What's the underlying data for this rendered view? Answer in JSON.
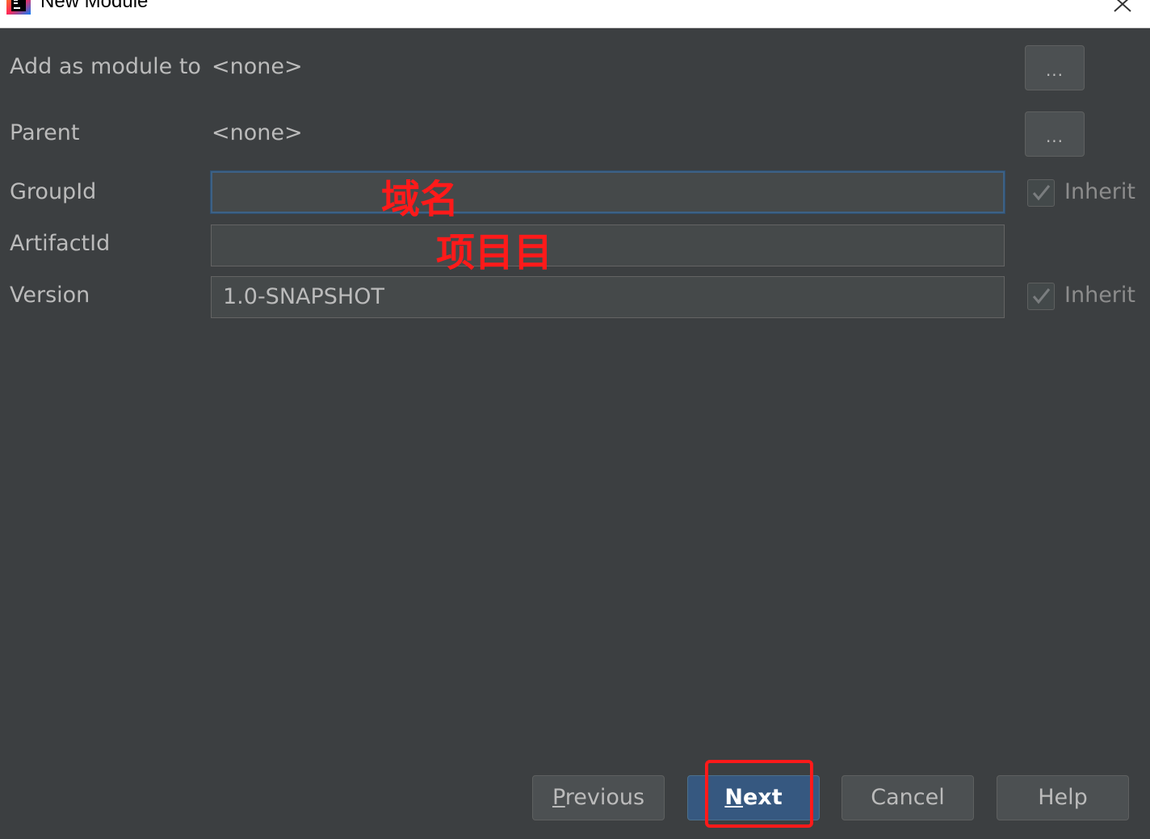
{
  "window": {
    "title": "New Module",
    "icon": "intellij-idea-icon",
    "close_icon": "close-icon"
  },
  "form": {
    "add_as_module_to": {
      "label": "Add as module to",
      "value": "<none>",
      "browse_label": "..."
    },
    "parent": {
      "label": "Parent",
      "value": "<none>",
      "browse_label": "..."
    },
    "group_id": {
      "label": "GroupId",
      "value": "",
      "annotation": "域名",
      "inherit_label": "Inherit",
      "inherit_checked": true
    },
    "artifact_id": {
      "label": "ArtifactId",
      "value": "",
      "annotation": "项目目"
    },
    "version": {
      "label": "Version",
      "value": "1.0-SNAPSHOT",
      "inherit_label": "Inherit",
      "inherit_checked": true
    }
  },
  "buttons": {
    "previous": {
      "mnemonic": "P",
      "rest": "revious"
    },
    "next": {
      "mnemonic": "N",
      "rest": "ext"
    },
    "cancel": "Cancel",
    "help": "Help"
  },
  "colors": {
    "background": "#3c3f41",
    "annotation": "#ff1a1a",
    "default_button": "#365880",
    "focus_border": "#3d6185"
  }
}
